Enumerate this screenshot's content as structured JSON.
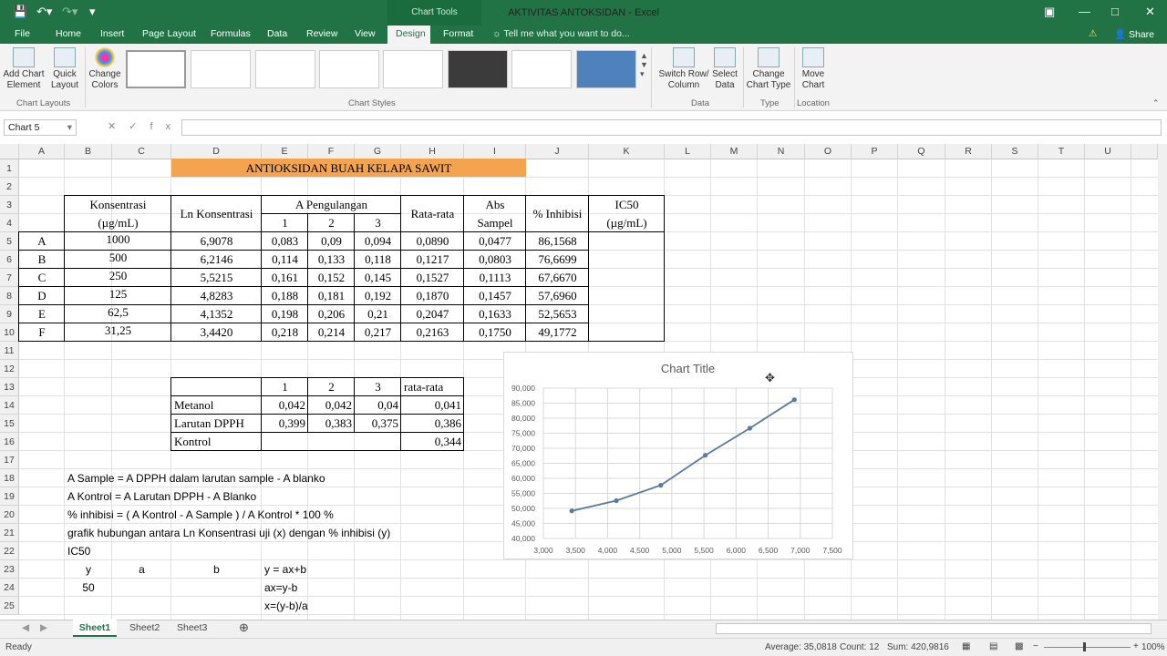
{
  "app": {
    "title": "AKTIVITAS ANTOKSIDAN - Excel",
    "context_tab": "Chart Tools",
    "quick_access": [
      "save-icon",
      "undo-icon",
      "redo-icon",
      "customize-icon"
    ],
    "window_controls": [
      "ribbon-options-icon",
      "minimize-icon",
      "maximize-icon",
      "close-icon"
    ]
  },
  "tabs": [
    "File",
    "Home",
    "Insert",
    "Page Layout",
    "Formulas",
    "Data",
    "Review",
    "View",
    "Design",
    "Format"
  ],
  "active_tab": "Design",
  "tell_me": "Tell me what you want to do...",
  "share": "Share",
  "ribbon": {
    "add_chart_element": "Add Chart Element",
    "quick_layout": "Quick Layout",
    "change_colors": "Change Colors",
    "chart_layouts_label": "Chart Layouts",
    "chart_styles_label": "Chart Styles",
    "switch_row_column": "Switch Row/ Column",
    "select_data": "Select Data",
    "data_label": "Data",
    "change_chart_type": "Change Chart Type",
    "type_label": "Type",
    "move_chart": "Move Chart",
    "location_label": "Location"
  },
  "formula_bar": {
    "name_box": "Chart 5",
    "fx": "fx",
    "value": ""
  },
  "columns": [
    "A",
    "B",
    "C",
    "D",
    "E",
    "F",
    "G",
    "H",
    "I",
    "J",
    "K",
    "L",
    "M",
    "N",
    "O",
    "P",
    "Q",
    "R",
    "S",
    "T",
    "U"
  ],
  "rows": [
    "1",
    "2",
    "3",
    "4",
    "5",
    "6",
    "7",
    "8",
    "9",
    "10",
    "11",
    "12",
    "13",
    "14",
    "15",
    "16",
    "17",
    "18",
    "19",
    "20",
    "21",
    "22",
    "23",
    "24",
    "25"
  ],
  "sheet": {
    "title": "ANTIOKSIDAN BUAH KELAPA SAWIT",
    "headers": {
      "konsentrasi": "Konsentrasi",
      "konsentrasi_unit": "(µg/mL)",
      "ln_konsentrasi": "Ln Konsentrasi",
      "a_pengulangan": "A Pengulangan",
      "rep1": "1",
      "rep2": "2",
      "rep3": "3",
      "rata_rata": "Rata-rata",
      "abs": "Abs",
      "sampel": "Sampel",
      "inhibisi": "% Inhibisi",
      "ic50": "IC50",
      "ic50_unit": "(µg/mL)"
    },
    "data_rows": [
      {
        "id": "A",
        "konsentrasi": "1000",
        "ln": "6,9078",
        "r1": "0,083",
        "r2": "0,09",
        "r3": "0,094",
        "avg": "0,0890",
        "abs": "0,0477",
        "inh": "86,1568"
      },
      {
        "id": "B",
        "konsentrasi": "500",
        "ln": "6,2146",
        "r1": "0,114",
        "r2": "0,133",
        "r3": "0,118",
        "avg": "0,1217",
        "abs": "0,0803",
        "inh": "76,6699"
      },
      {
        "id": "C",
        "konsentrasi": "250",
        "ln": "5,5215",
        "r1": "0,161",
        "r2": "0,152",
        "r3": "0,145",
        "avg": "0,1527",
        "abs": "0,1113",
        "inh": "67,6670"
      },
      {
        "id": "D",
        "konsentrasi": "125",
        "ln": "4,8283",
        "r1": "0,188",
        "r2": "0,181",
        "r3": "0,192",
        "avg": "0,1870",
        "abs": "0,1457",
        "inh": "57,6960"
      },
      {
        "id": "E",
        "konsentrasi": "62,5",
        "ln": "4,1352",
        "r1": "0,198",
        "r2": "0,206",
        "r3": "0,21",
        "avg": "0,2047",
        "abs": "0,1633",
        "inh": "52,5653"
      },
      {
        "id": "F",
        "konsentrasi": "31,25",
        "ln": "3,4420",
        "r1": "0,218",
        "r2": "0,214",
        "r3": "0,217",
        "avg": "0,2163",
        "abs": "0,1750",
        "inh": "49,1772"
      }
    ],
    "control_table": {
      "headers": [
        "1",
        "2",
        "3",
        "rata-rata"
      ],
      "rows": [
        {
          "label": "Metanol",
          "v1": "0,042",
          "v2": "0,042",
          "v3": "0,04",
          "avg": "0,041"
        },
        {
          "label": "Larutan DPPH",
          "v1": "0,399",
          "v2": "0,383",
          "v3": "0,375",
          "avg": "0,386"
        },
        {
          "label": "Kontrol",
          "v1": "",
          "v2": "",
          "v3": "",
          "avg": "0,344"
        }
      ]
    },
    "notes": [
      "A Sample = A DPPH dalam larutan sample - A blanko",
      "A Kontrol = A Larutan DPPH - A Blanko",
      "% inhibisi = ( A Kontrol - A Sample ) / A Kontrol * 100 %",
      "grafik hubungan antara Ln Konsentrasi uji (x) dengan % inhibisi (y)",
      "IC50"
    ],
    "ic50_block": {
      "y_label": "y",
      "a_label": "a",
      "b_label": "b",
      "eq1": "y = ax+b",
      "y_value": "50",
      "eq2": "ax=y-b",
      "eq3": "x=(y-b)/a"
    }
  },
  "chart_data": {
    "type": "scatter",
    "title": "Chart Title",
    "x": [
      3.442,
      4.1352,
      4.8283,
      5.5215,
      6.2146,
      6.9078
    ],
    "y": [
      49.1772,
      52.5653,
      57.696,
      67.667,
      76.6699,
      86.1568
    ],
    "xlim": [
      3.0,
      7.5
    ],
    "ylim": [
      40.0,
      90.0
    ],
    "x_ticks": [
      "3,000",
      "3,500",
      "4,000",
      "4,500",
      "5,000",
      "5,500",
      "6,000",
      "6,500",
      "7,000",
      "7,500"
    ],
    "y_ticks": [
      "40,000",
      "45,000",
      "50,000",
      "55,000",
      "60,000",
      "65,000",
      "70,000",
      "75,000",
      "80,000",
      "85,000",
      "90,000"
    ],
    "grid": true,
    "line_color": "#5b7a99",
    "xlabel": "",
    "ylabel": ""
  },
  "sheet_tabs": [
    "Sheet1",
    "Sheet2",
    "Sheet3"
  ],
  "active_sheet": "Sheet1",
  "status": {
    "ready": "Ready",
    "average": "Average: 35,0818",
    "count": "Count: 12",
    "sum": "Sum: 420,9816",
    "zoom": "100%"
  },
  "colors": {
    "excel_green": "#217346",
    "title_fill": "#f4a34f"
  }
}
